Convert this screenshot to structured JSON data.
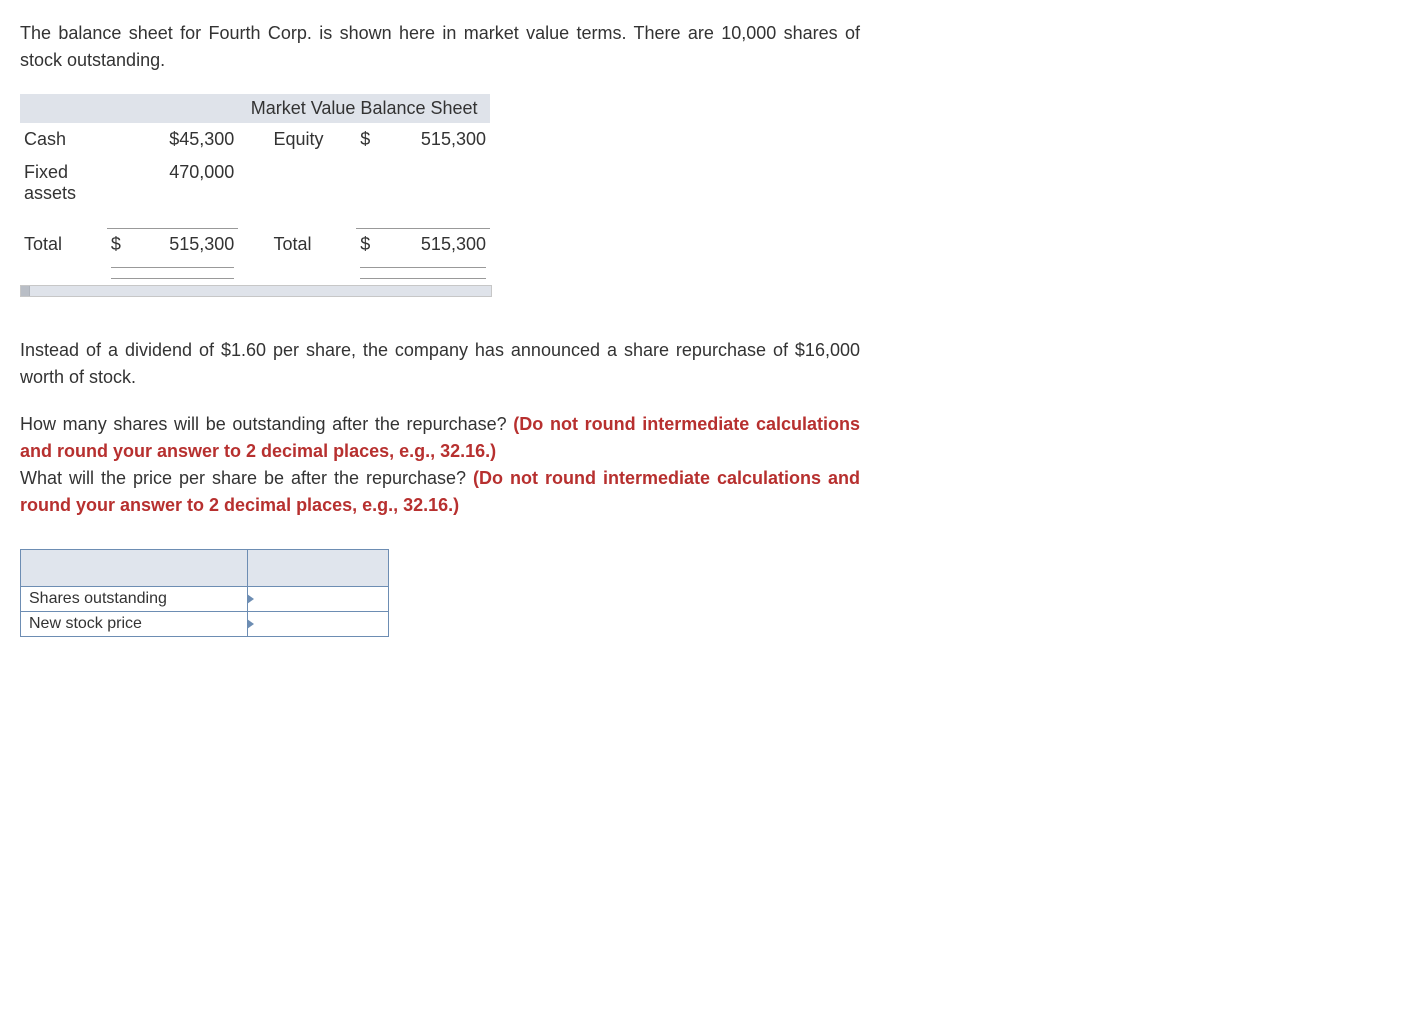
{
  "intro": "The balance sheet for Fourth Corp. is shown here in market value terms. There are 10,000 shares of stock outstanding.",
  "balance": {
    "title": "Market Value Balance Sheet",
    "rows": {
      "cash_label": "Cash",
      "cash_value": "$45,300",
      "equity_label": "Equity",
      "equity_dollar": "$",
      "equity_value": "515,300",
      "fixed_label": "Fixed assets",
      "fixed_value": "470,000",
      "total_left_label": "Total",
      "total_left_dollar": "$",
      "total_left_value": "515,300",
      "total_right_label": "Total",
      "total_right_dollar": "$",
      "total_right_value": "515,300"
    }
  },
  "para2": "Instead of a dividend of $1.60 per share, the company has announced a share repurchase of $16,000 worth of stock.",
  "q1_black": "How many shares will be outstanding after the repurchase? ",
  "q1_red": "(Do not round intermediate calculations and round your answer to 2 decimal places, e.g., 32.16.)",
  "q2_black": "What will the price per share be after the repurchase? ",
  "q2_red": "(Do not round intermediate calculations and round your answer to 2 decimal places, e.g., 32.16.)",
  "answers": {
    "row1_label": "Shares outstanding",
    "row1_value": "",
    "row2_label": "New stock price",
    "row2_value": ""
  }
}
